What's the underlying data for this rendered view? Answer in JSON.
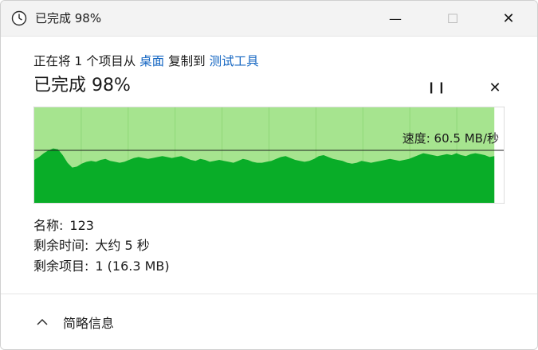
{
  "window": {
    "title": "已完成 98%",
    "minimize_label": "—",
    "maximize_label": "☐",
    "close_label": "✕"
  },
  "progress": {
    "percent": 98,
    "desc_prefix": "正在将 1 个项目从",
    "source": "桌面",
    "desc_middle": "复制到",
    "destination": "测试工具",
    "heading": "已完成 98%",
    "pause_label": "❙❙",
    "cancel_label": "✕"
  },
  "chart_data": {
    "type": "area",
    "speed_label": "速度: 60.5 MB/秒",
    "progress_fraction": 0.98,
    "speed_line_level": 0.55,
    "samples": [
      0.45,
      0.48,
      0.52,
      0.55,
      0.57,
      0.56,
      0.5,
      0.42,
      0.37,
      0.38,
      0.41,
      0.43,
      0.44,
      0.43,
      0.45,
      0.46,
      0.44,
      0.43,
      0.42,
      0.43,
      0.45,
      0.47,
      0.48,
      0.47,
      0.46,
      0.47,
      0.48,
      0.49,
      0.48,
      0.47,
      0.48,
      0.49,
      0.47,
      0.45,
      0.44,
      0.46,
      0.45,
      0.43,
      0.44,
      0.45,
      0.44,
      0.43,
      0.42,
      0.44,
      0.46,
      0.45,
      0.43,
      0.42,
      0.42,
      0.43,
      0.44,
      0.46,
      0.48,
      0.49,
      0.47,
      0.45,
      0.44,
      0.43,
      0.44,
      0.46,
      0.49,
      0.5,
      0.48,
      0.46,
      0.45,
      0.44,
      0.42,
      0.41,
      0.42,
      0.44,
      0.43,
      0.42,
      0.43,
      0.44,
      0.45,
      0.46,
      0.45,
      0.44,
      0.45,
      0.46,
      0.48,
      0.5,
      0.52,
      0.51,
      0.5,
      0.49,
      0.5,
      0.51,
      0.5,
      0.52,
      0.5,
      0.49,
      0.51,
      0.52,
      0.51,
      0.5,
      0.48,
      0.49
    ]
  },
  "details": {
    "name_label": "名称:",
    "name_value": "123",
    "time_label": "剩余时间:",
    "time_value": "大约 5 秒",
    "items_label": "剩余项目:",
    "items_value": "1 (16.3 MB)"
  },
  "footer": {
    "toggle_label": "简略信息"
  }
}
